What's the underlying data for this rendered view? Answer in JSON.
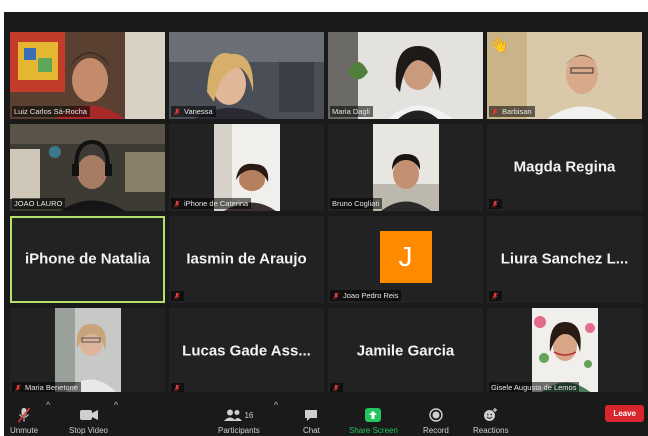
{
  "participants": [
    {
      "name": "Luiz Carlos Sá-Rocha",
      "muted": false
    },
    {
      "name": "Vanessa",
      "muted": true
    },
    {
      "name": "Maria Dagli",
      "muted": false
    },
    {
      "name": "Barbisan",
      "muted": true
    },
    {
      "name": "JOAO LAURO",
      "muted": false
    },
    {
      "name": "iPhone de Caterina",
      "muted": true
    },
    {
      "name": "Bruno Cogliati",
      "muted": false
    },
    {
      "name": "Magda Regina",
      "muted": true
    },
    {
      "name": "iPhone de Natalia",
      "muted": false
    },
    {
      "name": "Iasmin de Araujo",
      "muted": true
    },
    {
      "name": "Joao Pedro Reis",
      "muted": true,
      "initial": "J"
    },
    {
      "name": "Liura Sanchez L...",
      "muted": true
    },
    {
      "name": "Maria Benetone",
      "muted": true
    },
    {
      "name": "Lucas Gade Ass...",
      "muted": true
    },
    {
      "name": "Jamile Garcia",
      "muted": true
    },
    {
      "name": "Gisele Augusta de Lemos",
      "muted": false
    }
  ],
  "toolbar": {
    "unmute": "Unmute",
    "stop_video": "Stop Video",
    "participants": "Participants",
    "participant_count": "16",
    "chat": "Chat",
    "share_screen": "Share Screen",
    "record": "Record",
    "reactions": "Reactions",
    "leave": "Leave"
  },
  "colors": {
    "share_screen": "#22c55e",
    "leave": "#d8262e",
    "active_speaker": "#b3e06a",
    "mute_icon": "#e03a3a",
    "avatar_j": "#ff8a00"
  }
}
